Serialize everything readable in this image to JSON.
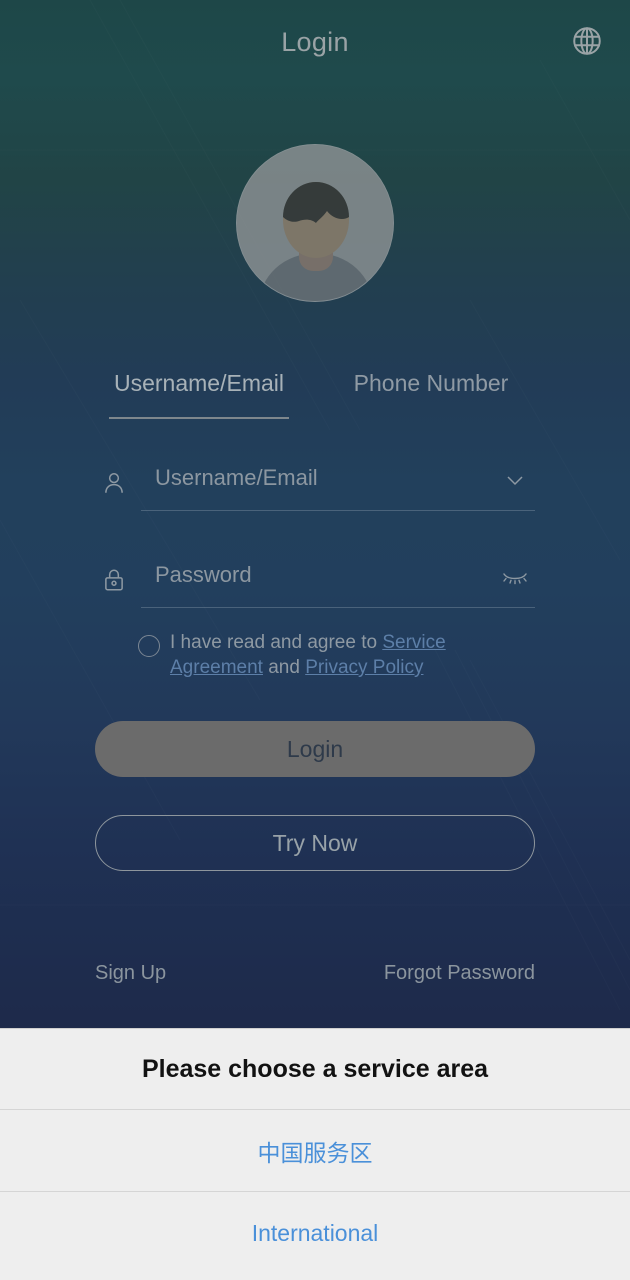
{
  "header": {
    "title": "Login",
    "language_icon": "globe-icon"
  },
  "avatar": {
    "icon": "default-user-avatar"
  },
  "tabs": [
    {
      "label": "Username/Email",
      "active": true
    },
    {
      "label": "Phone Number",
      "active": false
    }
  ],
  "fields": {
    "username": {
      "leading_icon": "person-icon",
      "placeholder": "Username/Email",
      "value": "",
      "trailing_icon": "chevron-down-icon"
    },
    "password": {
      "leading_icon": "lock-icon",
      "placeholder": "Password",
      "value": "",
      "trailing_icon": "eye-closed-icon"
    }
  },
  "agreement": {
    "checked": false,
    "prefix": "I have read and agree to ",
    "service_link": "Service Agreement",
    "conjunction": " and ",
    "privacy_link": "Privacy Policy"
  },
  "buttons": {
    "login": "Login",
    "try_now": "Try Now"
  },
  "footer": {
    "sign_up": "Sign Up",
    "forgot_password": "Forgot Password"
  },
  "sheet": {
    "title": "Please choose a service area",
    "options": [
      {
        "label": "中国服务区"
      },
      {
        "label": "International"
      }
    ]
  },
  "colors": {
    "gradient_top": "#1e4748",
    "gradient_mid": "#22405c",
    "gradient_bottom": "#1b2343",
    "login_button": "#6b6b6b",
    "link_blue": "#5d7fa8",
    "sheet_option_blue": "#4a90d9",
    "sheet_background": "#eeeeee"
  }
}
